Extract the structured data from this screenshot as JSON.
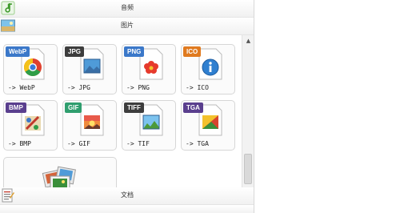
{
  "categories": {
    "audio": {
      "label": "音频",
      "icon": "music-note-icon"
    },
    "image": {
      "label": "图片",
      "icon": "picture-icon"
    },
    "document": {
      "label": "文档",
      "icon": "document-icon"
    }
  },
  "image_formats": [
    {
      "badge": "WebP",
      "caption": "-> WebP",
      "badge_color": "#3b78c9",
      "icon": "chrome-icon"
    },
    {
      "badge": "JPG",
      "caption": "-> JPG",
      "badge_color": "#3d3d3d",
      "icon": "landscape-icon"
    },
    {
      "badge": "PNG",
      "caption": "-> PNG",
      "badge_color": "#3b78c9",
      "icon": "flower-icon"
    },
    {
      "badge": "ICO",
      "caption": "-> ICO",
      "badge_color": "#e07a1f",
      "icon": "info-icon"
    },
    {
      "badge": "BMP",
      "caption": "-> BMP",
      "badge_color": "#5a3f8e",
      "icon": "paint-icon"
    },
    {
      "badge": "GIF",
      "caption": "-> GIF",
      "badge_color": "#2f9e6e",
      "icon": "sunset-icon"
    },
    {
      "badge": "TIFF",
      "caption": "-> TIF",
      "badge_color": "#3d3d3d",
      "icon": "landscape-icon"
    },
    {
      "badge": "TGA",
      "caption": "-> TGA",
      "badge_color": "#5a3f8e",
      "icon": "gradient-icon"
    }
  ],
  "wide_tile": {
    "icon": "photo-stack-icon"
  },
  "colors": {
    "panel_border": "#d8d8d8",
    "tile_border": "#d6d6d6"
  }
}
